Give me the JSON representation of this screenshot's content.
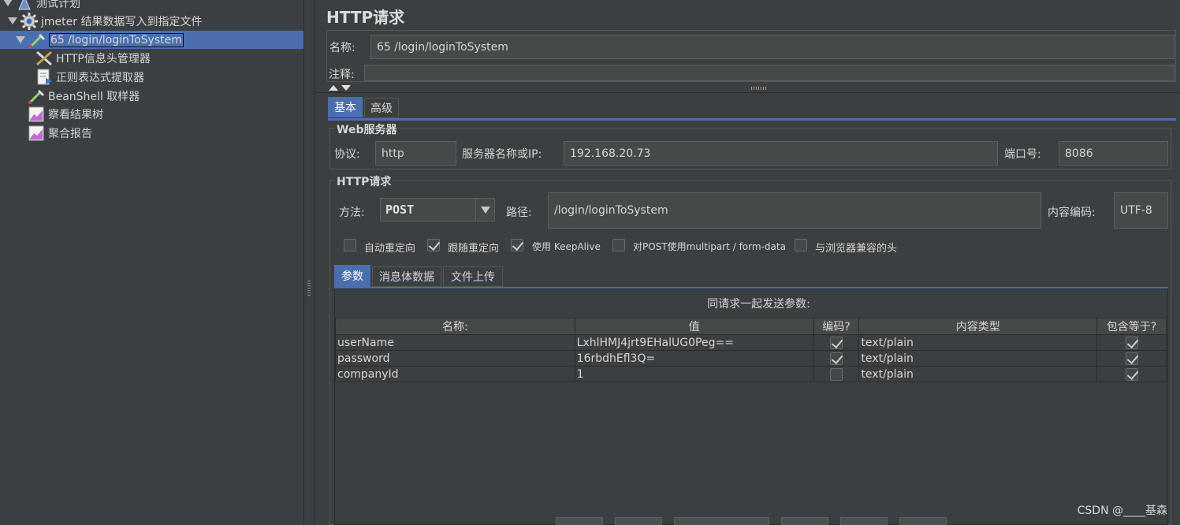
{
  "tree": {
    "items": [
      {
        "label": "测试计划",
        "icon": "test-plan-icon"
      },
      {
        "label": "jmeter 结果数据写入到指定文件",
        "icon": "thread-group-gear-icon"
      },
      {
        "label": "65 /login/loginToSystem",
        "icon": "http-sampler-pipette-icon"
      },
      {
        "label": "HTTP信息头管理器",
        "icon": "header-manager-tools-icon"
      },
      {
        "label": "正则表达式提取器",
        "icon": "regex-extractor-doc-icon"
      },
      {
        "label": "BeanShell 取样器",
        "icon": "beanshell-pipette-icon"
      },
      {
        "label": "察看结果树",
        "icon": "results-tree-chart-icon"
      },
      {
        "label": "聚合报告",
        "icon": "aggregate-report-chart-icon"
      }
    ]
  },
  "panel": {
    "title": "HTTP请求",
    "name_label": "名称:",
    "name_value": "65 /login/loginToSystem",
    "comment_label": "注释:",
    "comment_value": "",
    "tabs": [
      {
        "label": "基本"
      },
      {
        "label": "高级"
      }
    ],
    "web_server": {
      "legend": "Web服务器",
      "protocol_label": "协议:",
      "protocol_value": "http",
      "server_label": "服务器名称或IP:",
      "server_value": "192.168.20.73",
      "port_label": "端口号:",
      "port_value": "8086"
    },
    "http_request": {
      "legend": "HTTP请求",
      "method_label": "方法:",
      "method_value": "POST",
      "path_label": "路径:",
      "path_value": "/login/loginToSystem",
      "encoding_label": "内容编码:",
      "encoding_value": "UTF-8"
    },
    "options": [
      {
        "label": "自动重定向",
        "checked": false
      },
      {
        "label": "跟随重定向",
        "checked": true
      },
      {
        "label": "使用 KeepAlive",
        "checked": true
      },
      {
        "label": "对POST使用multipart / form-data",
        "checked": false
      },
      {
        "label": "与浏览器兼容的头",
        "checked": false
      }
    ],
    "sub_tabs": [
      {
        "label": "参数"
      },
      {
        "label": "消息体数据"
      },
      {
        "label": "文件上传"
      }
    ],
    "params_caption": "同请求一起发送参数:",
    "params_headers": [
      "名称:",
      "值",
      "编码?",
      "内容类型",
      "包含等于?"
    ],
    "params_rows": [
      {
        "name": "userName",
        "value": "LxhlHMJ4jrt9EHalUG0Peg==",
        "encode": true,
        "content_type": "text/plain",
        "include_equals": true
      },
      {
        "name": "password",
        "value": "16rbdhEfl3Q=",
        "encode": true,
        "content_type": "text/plain",
        "include_equals": true
      },
      {
        "name": "companyId",
        "value": "1",
        "encode": false,
        "content_type": "text/plain",
        "include_equals": true
      }
    ]
  },
  "watermark": "CSDN @____基森",
  "colors": {
    "selection": "#4b6eaf",
    "background": "#3c3f41",
    "field": "#45494a"
  }
}
